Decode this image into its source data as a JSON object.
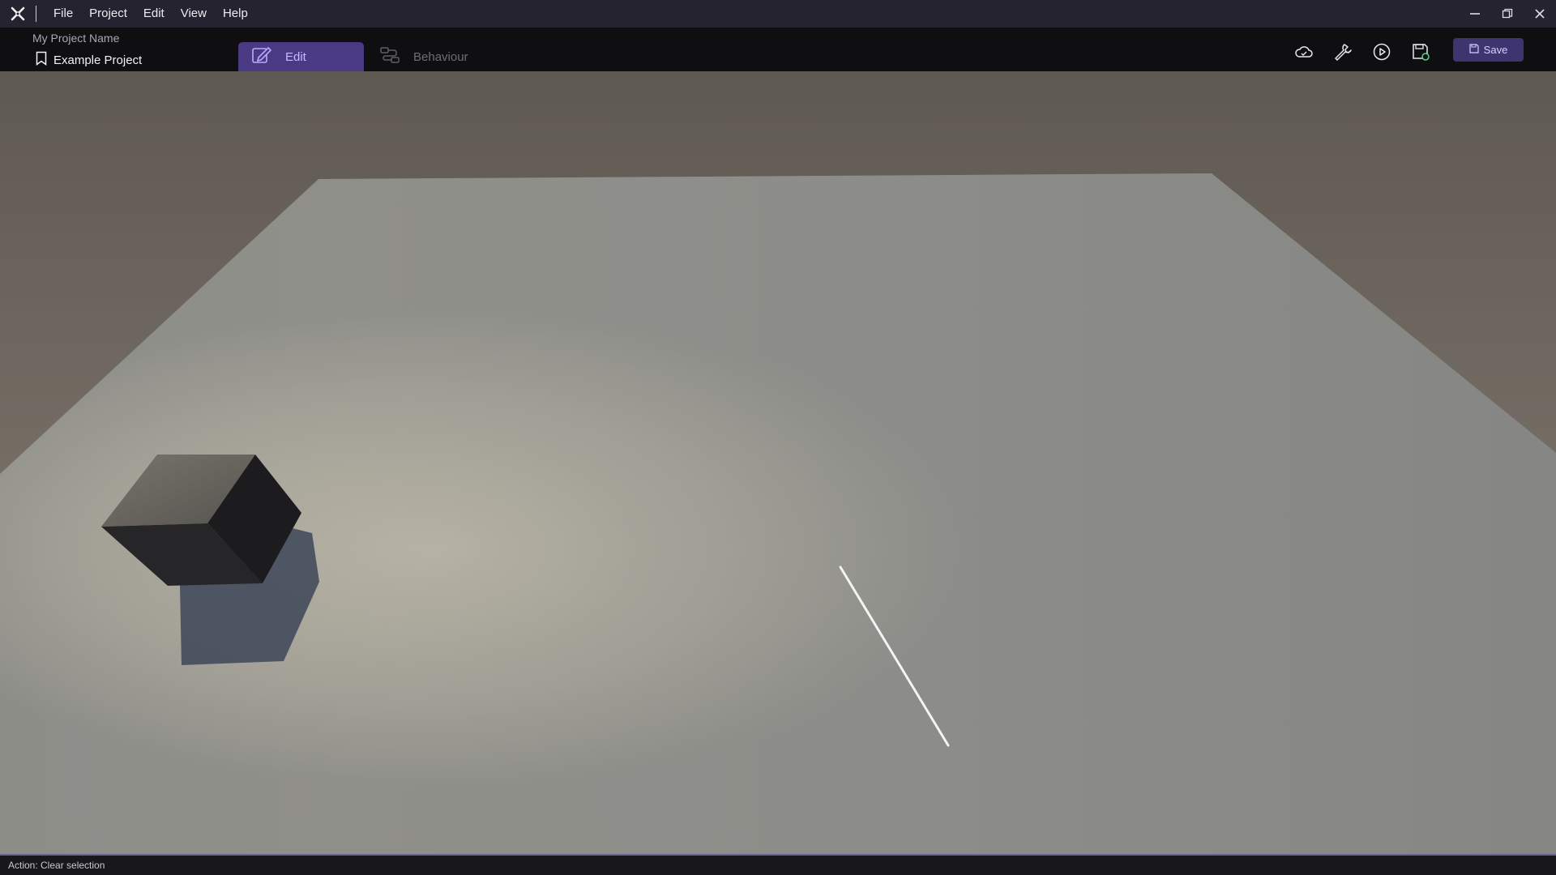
{
  "menubar": {
    "logo": "app-logo-icon",
    "items": [
      {
        "label": "File"
      },
      {
        "label": "Project"
      },
      {
        "label": "Edit"
      },
      {
        "label": "View"
      },
      {
        "label": "Help"
      }
    ],
    "window_controls": [
      "minimize-icon",
      "restore-icon",
      "close-icon"
    ]
  },
  "project": {
    "name_label": "My Project Name",
    "title": "Example Project",
    "icon": "bookmark-icon"
  },
  "mode_tabs": [
    {
      "label": "Edit",
      "icon": "edit-icon",
      "active": true
    },
    {
      "label": "Behaviour",
      "icon": "behaviour-flow-icon",
      "active": false
    }
  ],
  "toolbar": {
    "icons": [
      "cloud-icon",
      "wrench-icon",
      "play-icon",
      "save-config-icon"
    ],
    "save_label": "Save"
  },
  "statusbar": {
    "text": "Action: Clear selection"
  },
  "colors": {
    "accent": "#4a3a84",
    "accent_text": "#c6b9ff",
    "menubar": "#25232f",
    "toolbar": "#0f0f12"
  }
}
